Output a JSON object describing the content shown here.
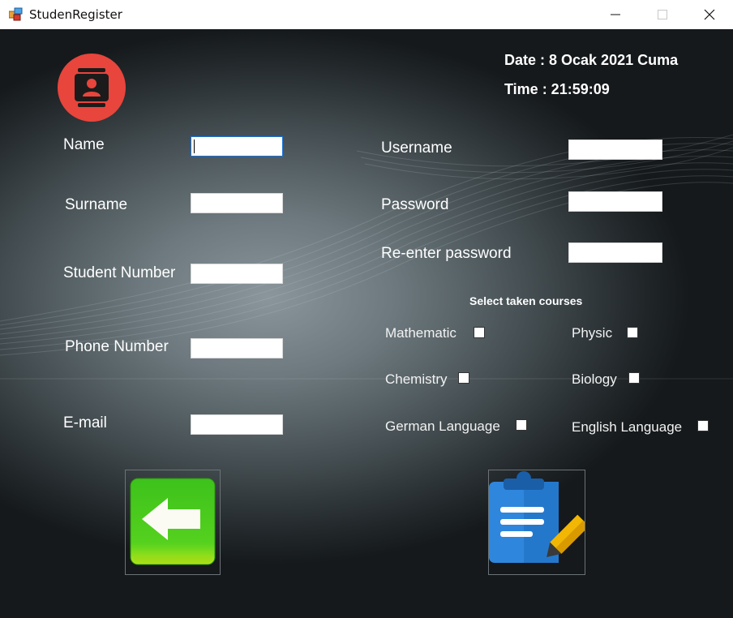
{
  "window": {
    "title": "StudenRegister",
    "icon": "windows-forms-app-icon"
  },
  "datetime": {
    "date_text": "Date : 8 Ocak 2021 Cuma",
    "time_text": "Time : 21:59:09"
  },
  "left_form": {
    "name_label": "Name",
    "surname_label": "Surname",
    "student_number_label": "Student Number",
    "phone_number_label": "Phone Number",
    "email_label": "E-mail"
  },
  "right_form": {
    "username_label": "Username",
    "password_label": "Password",
    "reenter_password_label": "Re-enter password"
  },
  "courses": {
    "header": "Select taken courses",
    "mathematic": "Mathematic",
    "physic": "Physic",
    "chemistry": "Chemistry",
    "biology": "Biology",
    "german": "German Language",
    "english": "English Language"
  },
  "icons": {
    "profile": "contact-card-icon",
    "back": "back-arrow-icon",
    "register": "clipboard-edit-icon"
  },
  "colors": {
    "accent_red": "#e8453c",
    "green": "#3cc01a",
    "blue": "#2f86dd",
    "pencil": "#f2b705"
  }
}
